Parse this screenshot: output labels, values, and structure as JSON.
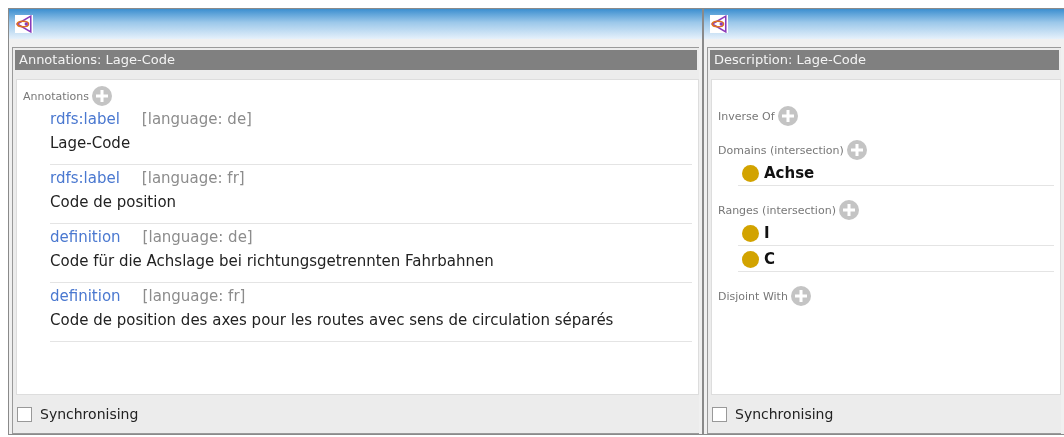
{
  "windows": [
    {
      "panel_title": "Annotations: Lage-Code",
      "sections": [
        {
          "kind": "annotations",
          "label": "Annotations",
          "items": [
            {
              "property": "rdfs:label",
              "language": "[language: de]",
              "value": "Lage-Code"
            },
            {
              "property": "rdfs:label",
              "language": "[language: fr]",
              "value": "Code de position"
            },
            {
              "property": "definition",
              "language": "[language: de]",
              "value": "Code für die Achslage bei richtungsgetrennten Fahrbahnen"
            },
            {
              "property": "definition",
              "language": "[language: fr]",
              "value": "Code de position des axes pour les routes avec sens de circulation séparés"
            }
          ]
        }
      ],
      "synchronising": {
        "label": "Synchronising",
        "checked": false
      }
    },
    {
      "panel_title": "Description: Lage-Code",
      "sections": [
        {
          "kind": "entities",
          "label": "Inverse Of"
        },
        {
          "kind": "entities",
          "label": "Domains (intersection)",
          "items": [
            {
              "name": "Achse"
            }
          ]
        },
        {
          "kind": "entities",
          "label": "Ranges (intersection)",
          "items": [
            {
              "name": "I"
            },
            {
              "name": "C"
            }
          ]
        },
        {
          "kind": "entities",
          "label": "Disjoint With"
        }
      ],
      "synchronising": {
        "label": "Synchronising",
        "checked": false
      }
    }
  ]
}
